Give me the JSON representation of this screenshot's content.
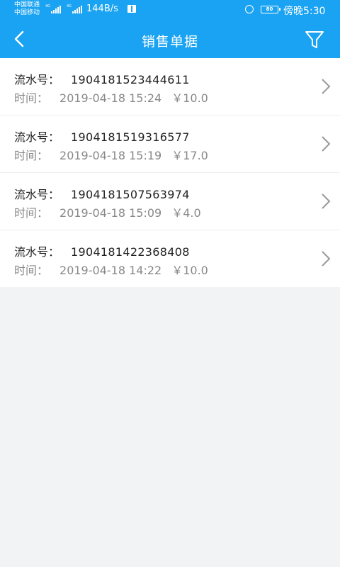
{
  "status_bar": {
    "carrier1": "中国联通",
    "carrier2": "中国移动",
    "net1": "4G",
    "net2": "4G",
    "speed": "144B/s",
    "battery": "80",
    "clock": "傍晚5:30"
  },
  "header": {
    "title": "销售单据"
  },
  "labels": {
    "serial": "流水号：",
    "time": "时间："
  },
  "records": [
    {
      "serial": "1904181523444611",
      "time": "2019-04-18 15:24",
      "amount": "￥10.0"
    },
    {
      "serial": "1904181519316577",
      "time": "2019-04-18 15:19",
      "amount": "￥17.0"
    },
    {
      "serial": "1904181507563974",
      "time": "2019-04-18 15:09",
      "amount": "￥4.0"
    },
    {
      "serial": "1904181422368408",
      "time": "2019-04-18 14:22",
      "amount": "￥10.0"
    }
  ],
  "colors": {
    "primary": "#1aa3f2",
    "background": "#f2f3f5"
  },
  "icons": [
    "back-icon",
    "filter-icon",
    "chevron-right-icon",
    "alarm-icon",
    "battery-icon",
    "book-icon"
  ]
}
